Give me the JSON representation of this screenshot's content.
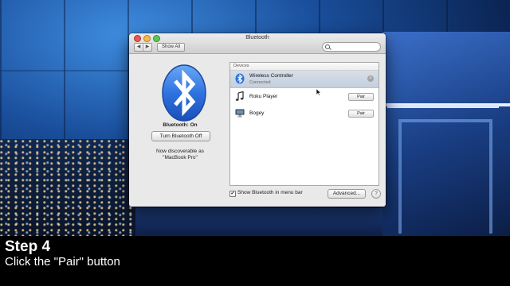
{
  "window": {
    "title": "Bluetooth",
    "toolbar": {
      "back_glyph": "◀",
      "forward_glyph": "▶",
      "show_all_label": "Show All",
      "search_placeholder": ""
    }
  },
  "bluetooth": {
    "status": "Bluetooth: On",
    "toggle_label": "Turn Bluetooth Off",
    "discoverable_line1": "Now discoverable as",
    "discoverable_line2": "\"MacBook Pro\""
  },
  "devices": {
    "header": "Devices",
    "items": [
      {
        "name": "Wireless Controller",
        "status": "Connected",
        "icon": "bluetooth-icon",
        "action": "×",
        "selected": true
      },
      {
        "name": "Roku Player",
        "status": "",
        "icon": "music-note-icon",
        "action": "Pair",
        "selected": false
      },
      {
        "name": "Bogey",
        "status": "",
        "icon": "computer-icon",
        "action": "Pair",
        "selected": false
      }
    ]
  },
  "footer": {
    "show_in_menu_bar_label": "Show Bluetooth in menu bar",
    "show_in_menu_bar_checked": true,
    "checkmark": "✔",
    "advanced_label": "Advanced...",
    "help_label": "?"
  },
  "caption": {
    "step": "Step 4",
    "instruction": "Click the \"Pair\" button"
  },
  "colors": {
    "bluetooth_blue": "#2f73e0",
    "selected_row": "#c9d3df"
  }
}
